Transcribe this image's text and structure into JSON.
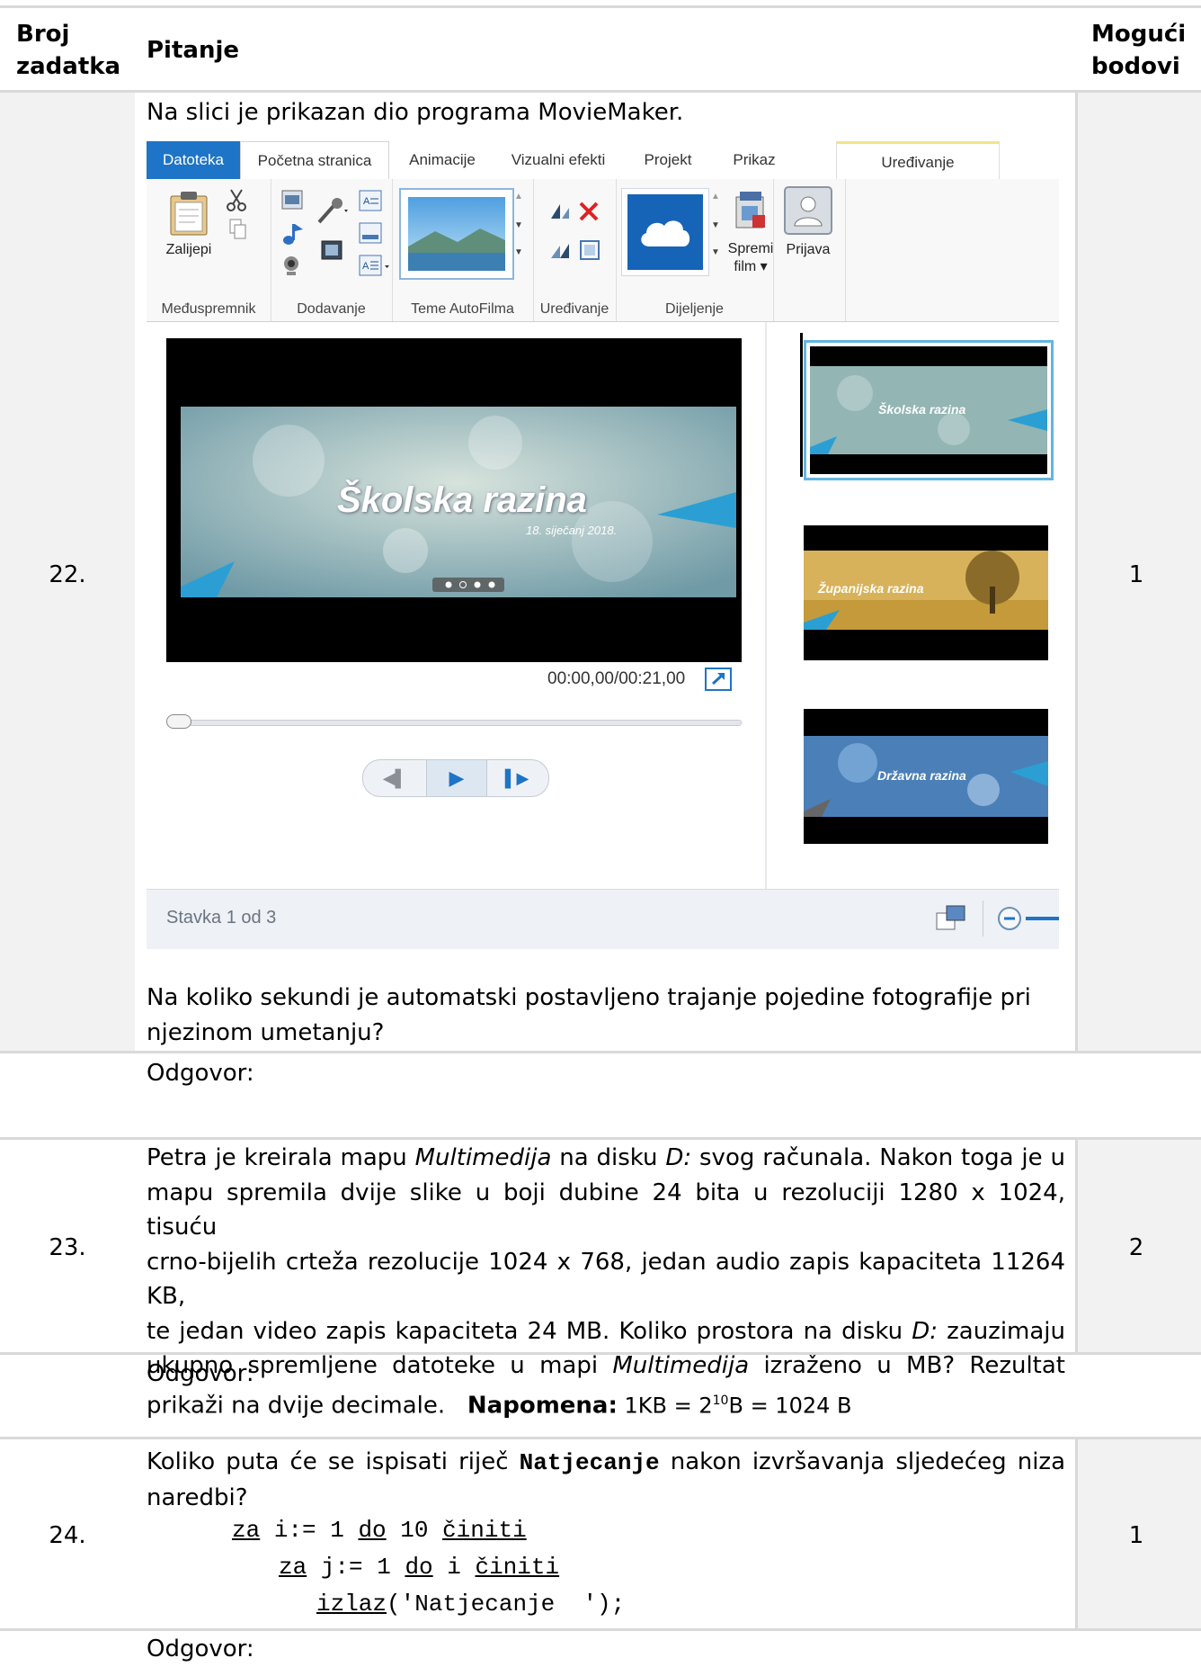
{
  "header": {
    "col_number": "Broj zadatka",
    "col_number_line1": "Broj",
    "col_number_line2": "zadatka",
    "col_question": "Pitanje",
    "col_points_line1": "Mogući",
    "col_points_line2": "bodovi"
  },
  "q22": {
    "number": "22.",
    "points": "1",
    "intro": "Na slici je prikazan dio programa MovieMaker.",
    "question_line1": "Na koliko sekundi je automatski postavljeno trajanje pojedine fotografije pri",
    "question_line2": "njezinom umetanju?",
    "answer_label": "Odgovor:"
  },
  "moviemaker": {
    "tabs": [
      "Datoteka",
      "Početna stranica",
      "Animacije",
      "Vizualni efekti",
      "Projekt",
      "Prikaz",
      "Uređivanje"
    ],
    "groups": [
      "Međuspremnik",
      "Dodavanje",
      "Teme AutoFilma",
      "Uređivanje",
      "Dijeljenje"
    ],
    "paste_label": "Zalijepi",
    "save_movie_line1": "Spremi",
    "save_movie_line2": "film",
    "signin_label": "Prijava",
    "preview_title": "Školska razina",
    "preview_date": "18. siječanj 2018.",
    "timecode": "00:00,00/00:21,00",
    "thumbs": [
      "Školska razina",
      "Županijska razina",
      "Državna razina"
    ],
    "status_text": "Stavka 1 od 3",
    "progress": 0
  },
  "q23": {
    "number": "23.",
    "points": "2",
    "lines": [
      [
        "Petra je kreirala mapu ",
        "Multimedija",
        " na disku ",
        "D:",
        " svog računala. Nakon toga je u"
      ],
      [
        "mapu spremila dvije slike u boji dubine 24 bita u rezoluciji 1280 x 1024, tisuću"
      ],
      [
        "crno-bijelih crteža rezolucije 1024 x 768, jedan audio zapis kapaciteta 11264 KB,"
      ],
      [
        "te jedan video zapis kapaciteta 24 MB. Koliko prostora na disku ",
        "D:",
        " zauzimaju"
      ],
      [
        "ukupno spremljene datoteke u mapi ",
        "Multimedija",
        " izraženo u MB?  Rezultat"
      ]
    ],
    "last_line_pre": "prikaži na dvije decimale.",
    "note_label": "Napomena:",
    "note_text_a": " 1KB = 2",
    "note_sup": "10",
    "note_text_b": "B = 1024 B",
    "answer_label": "Odgovor:"
  },
  "q24": {
    "number": "24.",
    "points": "1",
    "q_a": "Koliko puta će se ispisati riječ ",
    "q_word": "Natjecanje",
    "q_b": " nakon izvršavanja sljedećeg niza",
    "q_line2": "naredbi?",
    "code1_kw1": "za",
    "code1_mid": " i:= 1 ",
    "code1_kw2": "do",
    "code1_mid2": " 10 ",
    "code1_kw3": "činiti",
    "code2_kw1": "za",
    "code2_mid": " j:= 1 ",
    "code2_kw2": "do",
    "code2_mid2": " i ",
    "code2_kw3": "činiti",
    "code3_kw": "izlaz",
    "code3_rest": "('Natjecanje  ');",
    "answer_label": "Odgovor:"
  }
}
